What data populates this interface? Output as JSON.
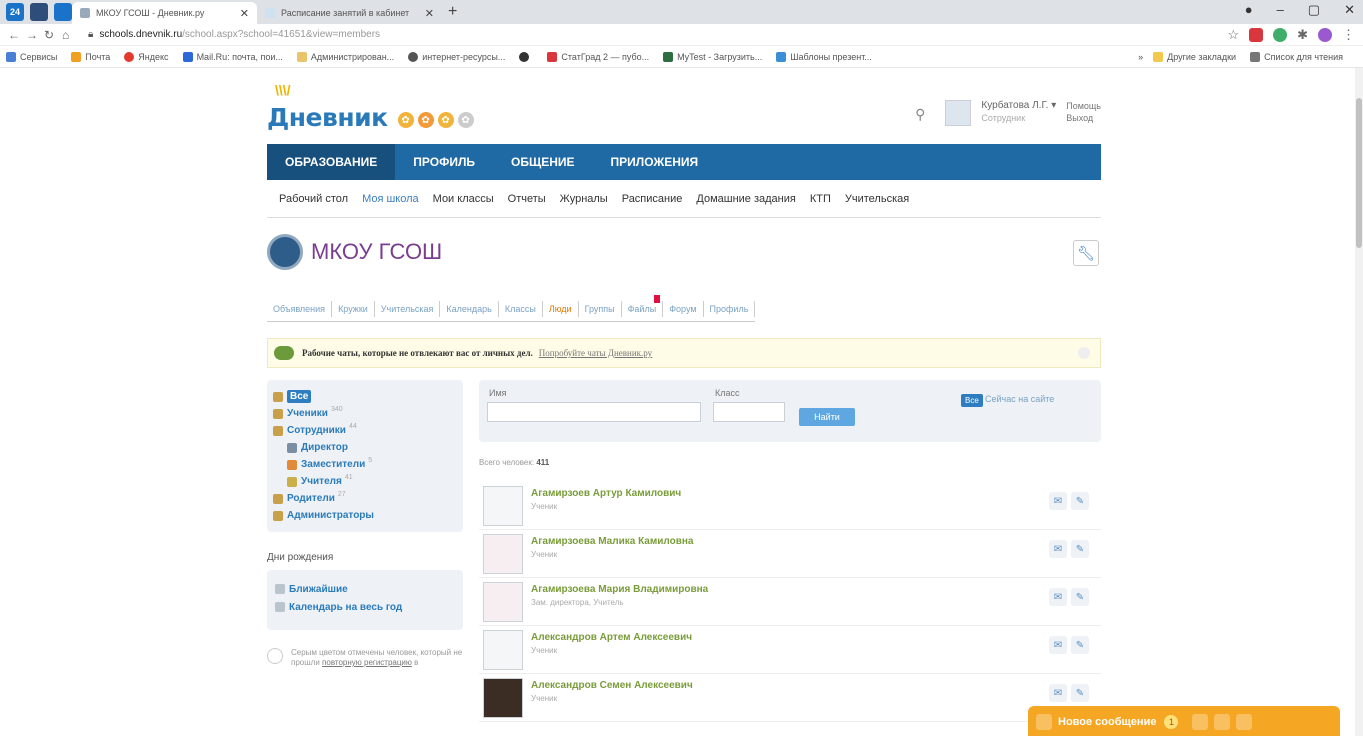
{
  "browser": {
    "pinned": [
      "24",
      "",
      ""
    ],
    "tabs": [
      {
        "title": "МКОУ ГСОШ - Дневник.ру",
        "active": true
      },
      {
        "title": "Расписание занятий в кабинет",
        "active": false
      }
    ],
    "url_host": "schools.dnevnik.ru",
    "url_path": "/school.aspx?school=41651&view=members",
    "bookmarks": [
      "Сервисы",
      "Почта",
      "Яндекс",
      "Mail.Ru: почта, пои...",
      "Администрирован...",
      "интернет-ресурсы...",
      "",
      "СтатГрад 2 — пубо...",
      "MyTest - Загрузить...",
      "Шаблоны презент..."
    ],
    "bookmarks_right": [
      "Другие закладки",
      "Список для чтения"
    ]
  },
  "site": {
    "logo": "Дневник",
    "user": {
      "name": "Курбатова Л.Г.",
      "role": "Сотрудник"
    },
    "help": {
      "help": "Помощь",
      "logout": "Выход"
    },
    "main_nav": [
      "ОБРАЗОВАНИЕ",
      "ПРОФИЛЬ",
      "ОБЩЕНИЕ",
      "ПРИЛОЖЕНИЯ"
    ],
    "sub_nav": [
      "Рабочий стол",
      "Моя школа",
      "Мои классы",
      "Отчеты",
      "Журналы",
      "Расписание",
      "Домашние задания",
      "КТП",
      "Учительская"
    ],
    "school_name": "МКОУ ГСОШ",
    "school_tabs": [
      "Объявления",
      "Кружки",
      "Учительская",
      "Календарь",
      "Классы",
      "Люди",
      "Группы",
      "Файлы",
      "Форум",
      "Профиль"
    ],
    "notice": {
      "bold": "Рабочие чаты, которые не отвлекают вас от личных дел.",
      "link": "Попробуйте чаты Дневник.ру"
    },
    "left_panel": [
      {
        "label": "Все",
        "count": "",
        "sub": false,
        "selected": true,
        "color": "#c9a04a"
      },
      {
        "label": "Ученики",
        "count": "340",
        "sub": false,
        "selected": false,
        "color": "#c9a04a"
      },
      {
        "label": "Сотрудники",
        "count": "44",
        "sub": false,
        "selected": false,
        "color": "#c9a04a"
      },
      {
        "label": "Директор",
        "count": "",
        "sub": true,
        "selected": false,
        "color": "#7a8fa3"
      },
      {
        "label": "Заместители",
        "count": "5",
        "sub": true,
        "selected": false,
        "color": "#e08a3a"
      },
      {
        "label": "Учителя",
        "count": "41",
        "sub": true,
        "selected": false,
        "color": "#c9b04a"
      },
      {
        "label": "Родители",
        "count": "27",
        "sub": false,
        "selected": false,
        "color": "#c9a04a"
      },
      {
        "label": "Администраторы",
        "count": "",
        "sub": false,
        "selected": false,
        "color": "#c9a04a"
      }
    ],
    "birthdays_title": "Дни рождения",
    "birthdays": [
      "Ближайшие",
      "Календарь на весь год"
    ],
    "hint": {
      "text": "Серым цветом отмечены человек, который не прошли",
      "link": "повторную регистрацию",
      "tail": "в"
    },
    "filter": {
      "name_label": "Имя",
      "class_label": "Класс",
      "find": "Найти",
      "all": "Все",
      "online": "Сейчас на сайте"
    },
    "total_label": "Всего человек:",
    "total_value": "411",
    "people": [
      {
        "name": "Агамирзоев Артур Камилович",
        "role": "Ученик",
        "avatar": "plain"
      },
      {
        "name": "Агамирзоева Малика Камиловна",
        "role": "Ученик",
        "avatar": "pink"
      },
      {
        "name": "Агамирзоева Мария Владимировна",
        "role": "Зам. директора, Учитель",
        "avatar": "pink"
      },
      {
        "name": "Александров Артем Алексеевич",
        "role": "Ученик",
        "avatar": "plain"
      },
      {
        "name": "Александров Семен Алексеевич",
        "role": "Ученик",
        "avatar": "photo"
      }
    ],
    "message_bar": {
      "title": "Новое сообщение",
      "count": "1"
    }
  }
}
